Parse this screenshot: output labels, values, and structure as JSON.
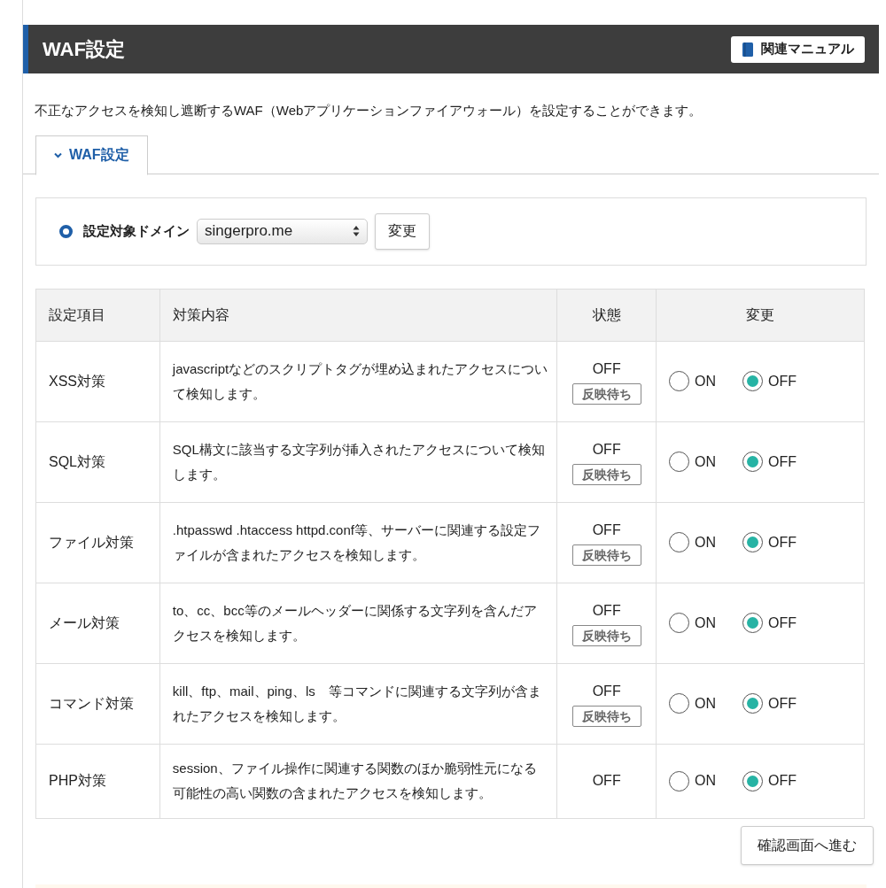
{
  "header": {
    "title": "WAF設定",
    "manual_button": "関連マニュアル"
  },
  "description": "不正なアクセスを検知し遮断するWAF（Webアプリケーションファイアウォール）を設定することができます。",
  "tabs": [
    {
      "label": "WAF設定",
      "selected": true,
      "expanded": true
    }
  ],
  "domain": {
    "label": "設定対象ドメイン",
    "selected": true,
    "value": "singerpro.me",
    "button": "変更"
  },
  "table": {
    "columns": [
      "設定項目",
      "対策内容",
      "状態",
      "変更"
    ],
    "rows": [
      {
        "item": "XSS対策",
        "description": "javascriptなどのスクリプトタグが埋め込まれたアクセスについて検知します。",
        "status": "OFF",
        "badge": "反映待ち",
        "options": [
          {
            "label": "ON",
            "selected": false
          },
          {
            "label": "OFF",
            "selected": true
          }
        ]
      },
      {
        "item": "SQL対策",
        "description": "SQL構文に該当する文字列が挿入されたアクセスについて検知します。",
        "status": "OFF",
        "badge": "反映待ち",
        "options": [
          {
            "label": "ON",
            "selected": false
          },
          {
            "label": "OFF",
            "selected": true
          }
        ]
      },
      {
        "item": "ファイル対策",
        "description": ".htpasswd .htaccess httpd.conf等、サーバーに関連する設定ファイルが含まれたアクセスを検知します。",
        "status": "OFF",
        "badge": "反映待ち",
        "options": [
          {
            "label": "ON",
            "selected": false
          },
          {
            "label": "OFF",
            "selected": true
          }
        ]
      },
      {
        "item": "メール対策",
        "description": "to、cc、bcc等のメールヘッダーに関係する文字列を含んだアクセスを検知します。",
        "status": "OFF",
        "badge": "反映待ち",
        "options": [
          {
            "label": "ON",
            "selected": false
          },
          {
            "label": "OFF",
            "selected": true
          }
        ]
      },
      {
        "item": "コマンド対策",
        "description": "kill、ftp、mail、ping、ls　等コマンドに関連する文字列が含まれたアクセスを検知します。",
        "status": "OFF",
        "badge": "反映待ち",
        "options": [
          {
            "label": "ON",
            "selected": false
          },
          {
            "label": "OFF",
            "selected": true
          }
        ]
      },
      {
        "item": "PHP対策",
        "description": "session、ファイル操作に関連する関数のほか脆弱性元になる可能性の高い関数の含まれたアクセスを検知します。",
        "status": "OFF",
        "options": [
          {
            "label": "ON",
            "selected": false
          },
          {
            "label": "OFF",
            "selected": true
          }
        ]
      }
    ]
  },
  "confirm_button": "確認画面へ進む"
}
